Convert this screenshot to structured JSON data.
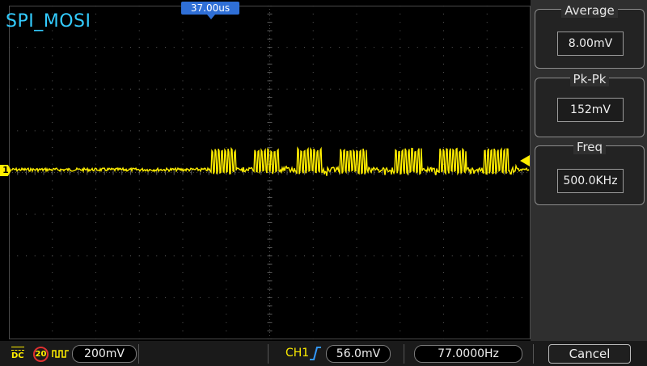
{
  "channel": {
    "name": "SPI_MOSI",
    "marker": "1"
  },
  "trigger": {
    "time_offset": "37.00us",
    "source": "CH1",
    "level": "56.0mV",
    "slope_icon": "rising-edge-icon"
  },
  "measurements": [
    {
      "title": "Average",
      "value": "8.00mV"
    },
    {
      "title": "Pk-Pk",
      "value": "152mV"
    },
    {
      "title": "Freq",
      "value": "500.0KHz"
    }
  ],
  "status_bar": {
    "coupling": "DC",
    "bw_limit": "20",
    "volts_per_div": "200mV",
    "frequency": "77.0000Hz",
    "cancel_label": "Cancel"
  },
  "colors": {
    "trace": "#ffee00",
    "label": "#33ccff",
    "trigger_flag": "#2f6fd6"
  }
}
